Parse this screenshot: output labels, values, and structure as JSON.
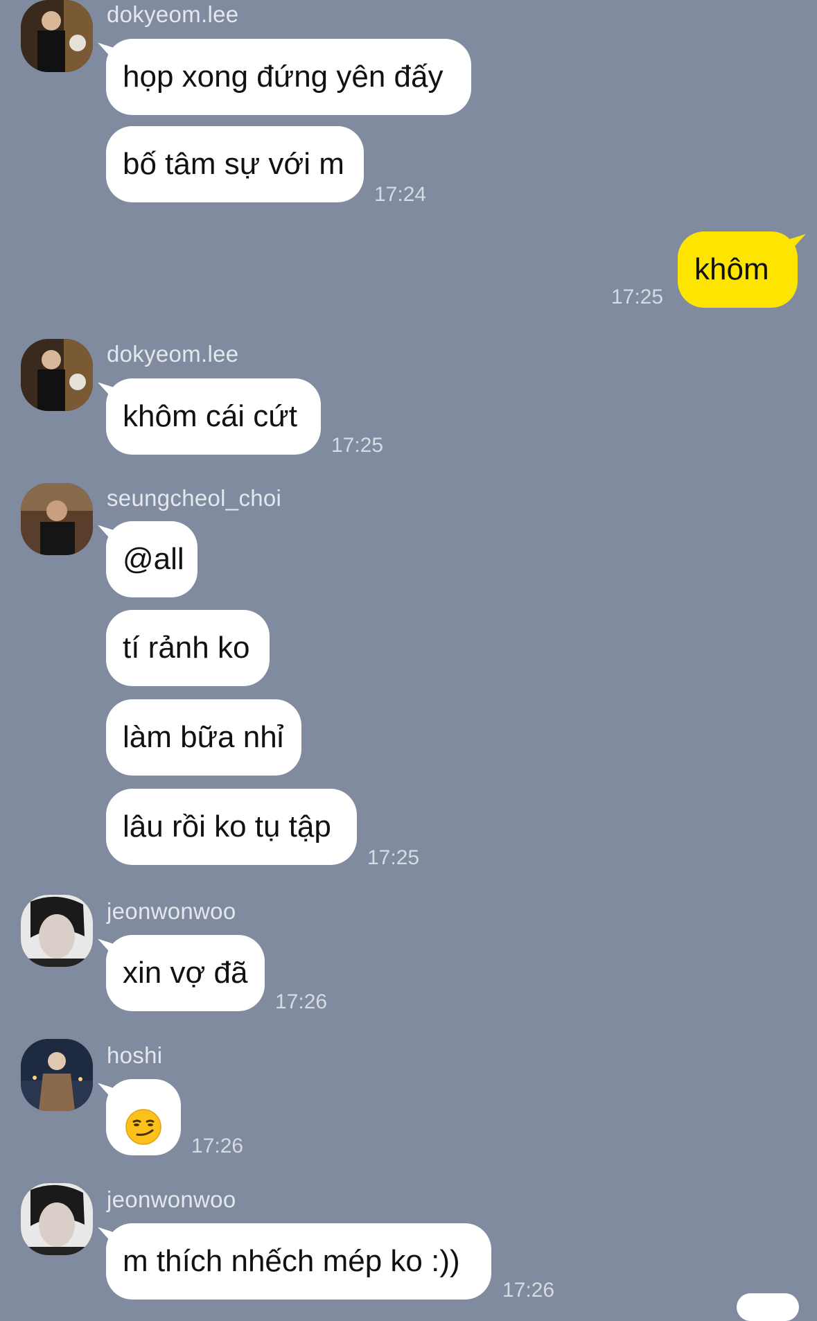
{
  "messages": [
    {
      "sender": "dokyeom.lee",
      "bubbles": [
        "họp xong đứng yên đấy",
        "bố tâm sự với m"
      ],
      "time": "17:24"
    },
    {
      "sender": "me",
      "bubbles": [
        "khôm"
      ],
      "time": "17:25"
    },
    {
      "sender": "dokyeom.lee",
      "bubbles": [
        "khôm cái cứt"
      ],
      "time": "17:25"
    },
    {
      "sender": "seungcheol_choi",
      "bubbles": [
        "@all",
        "tí rảnh ko",
        "làm bữa nhỉ",
        "lâu rồi ko tụ tập"
      ],
      "time": "17:25"
    },
    {
      "sender": "jeonwonwoo",
      "bubbles": [
        "xin vợ đã"
      ],
      "time": "17:26"
    },
    {
      "sender": "hoshi",
      "bubbles": [
        "😏"
      ],
      "time": "17:26"
    },
    {
      "sender": "jeonwonwoo",
      "bubbles": [
        "m thích nhếch mép ko :))"
      ],
      "time": "17:26"
    }
  ],
  "colors": {
    "background": "#818b9f",
    "incoming_bubble": "#ffffff",
    "outgoing_bubble": "#fee500"
  },
  "icons": {
    "smirk": "smirking-face-emoji"
  }
}
